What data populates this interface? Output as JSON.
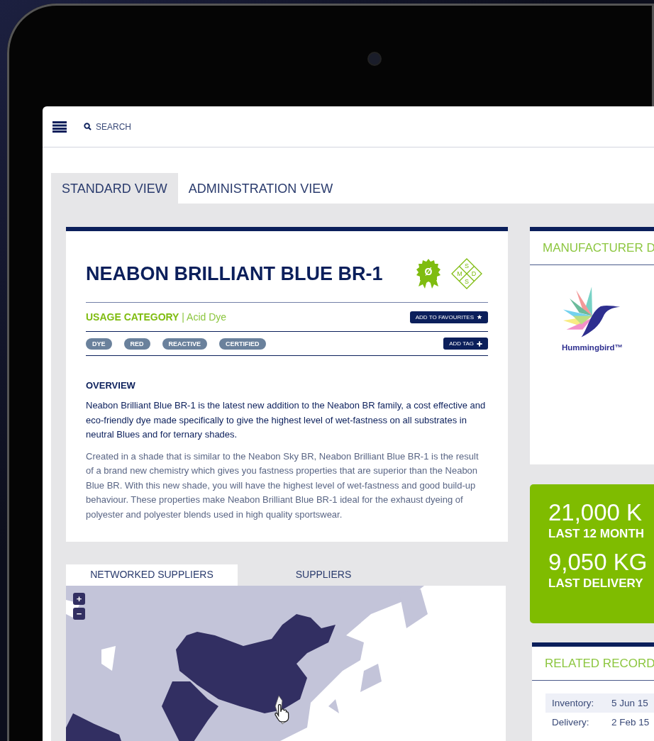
{
  "header": {
    "search_label": "SEARCH"
  },
  "view_tabs": [
    {
      "label": "STANDARD VIEW",
      "selected": true
    },
    {
      "label": "ADMINISTRATION VIEW",
      "selected": false
    }
  ],
  "product": {
    "title": "NEABON BRILLIANT BLUE BR-1",
    "badge_symbol": "Ø",
    "msds_letters": [
      "S",
      "M",
      "D",
      "S"
    ],
    "usage": "**USAGE CATEGORY** | Acid Dye",
    "favourites_button": "ADD TO FAVOURITES",
    "tags": [
      "DYE",
      "RED",
      "REACTIVE",
      "CERTIFIED"
    ],
    "add_tag_button": "ADD TAG",
    "overview_heading": "OVERVIEW",
    "overview_lead": "Neabon Brilliant Blue BR-1 is the latest new addition to the Neabon BR family, a cost effective and eco-friendly dye made specifically to give the highest level of wet-fastness on all substrates in neutral Blues and for ternary shades.",
    "overview_body": "Created in a shade that is similar to the Neabon Sky BR, Neabon Brilliant Blue BR-1 is the result of a brand new chemistry which gives you fastness properties that are superior than the Neabon Blue BR. With this new shade, you will have the highest level of wet-fastness and good build-up behaviour. These properties make Neabon Brilliant Blue BR-1 ideal for the exhaust dyeing of polyester and polyester blends used in high quality sportswear."
  },
  "supplier_tabs": [
    {
      "label": "NETWORKED SUPPLIERS",
      "selected": true
    },
    {
      "label": "SUPPLIERS",
      "selected": false
    }
  ],
  "map": {
    "zoom_in": "+",
    "zoom_out": "−"
  },
  "manufacturer": {
    "title": "MANUFACTURER D",
    "logo_text": "Hummingbird™"
  },
  "stats": [
    {
      "value": "21,000 K",
      "label": "LAST 12 MONTH"
    },
    {
      "value": "9,050 KG",
      "label": "LAST DELIVERY"
    }
  ],
  "related": {
    "title": "RELATED RECORD",
    "rows": [
      {
        "type": "Inventory:",
        "date": "5 Jun 15"
      },
      {
        "type": "Delivery:",
        "date": "2 Feb 15"
      }
    ]
  }
}
